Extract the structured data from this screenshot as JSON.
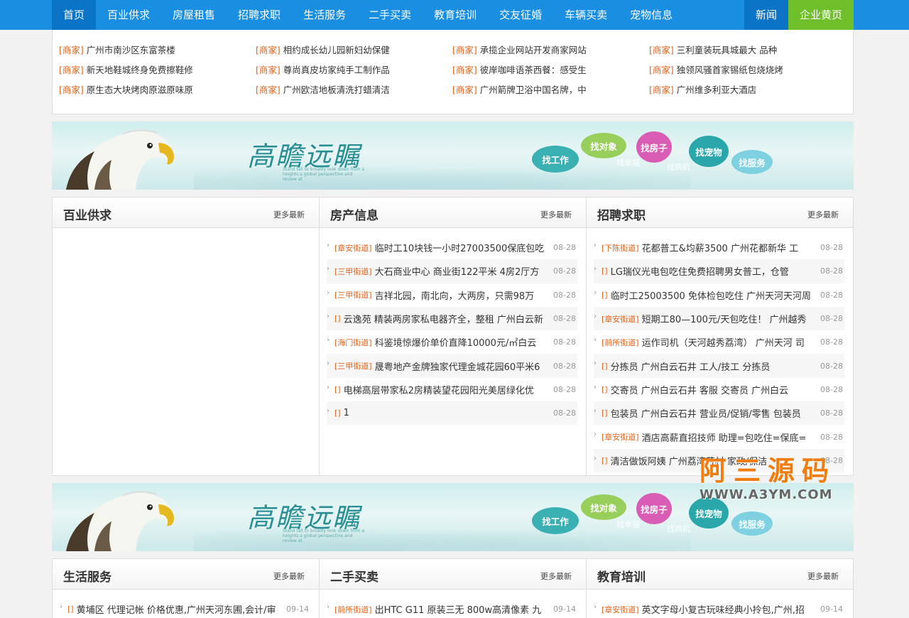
{
  "nav": {
    "items": [
      "首页",
      "百业供求",
      "房屋租售",
      "招聘求职",
      "生活服务",
      "二手买卖",
      "教育培训",
      "交友征婚",
      "车辆买卖",
      "宠物信息"
    ],
    "news": "新闻",
    "yellow_pages": "企业黄页"
  },
  "merchants": [
    {
      "tag": "[商家]",
      "text": "广州市南沙区东富茶楼"
    },
    {
      "tag": "[商家]",
      "text": "相约成长幼儿园新妇幼保健"
    },
    {
      "tag": "[商家]",
      "text": "承揽企业网站开发商家网站"
    },
    {
      "tag": "[商家]",
      "text": "三利童装玩具城最大 品种"
    },
    {
      "tag": "[商家]",
      "text": "新天地鞋城终身免费擦鞋修"
    },
    {
      "tag": "[商家]",
      "text": "尊尚真皮坊家纯手工制作品"
    },
    {
      "tag": "[商家]",
      "text": "彼岸咖啡语茶西餐：感受生"
    },
    {
      "tag": "[商家]",
      "text": "独领风骚首家锡纸包烧烧烤"
    },
    {
      "tag": "[商家]",
      "text": "原生态大块烤肉原滋原味原"
    },
    {
      "tag": "[商家]",
      "text": "广州欧洁地板清洗打蜡清洁"
    },
    {
      "tag": "[商家]",
      "text": "广州箭牌卫浴中国名牌，中"
    },
    {
      "tag": "[商家]",
      "text": "广州维多利亚大酒店"
    }
  ],
  "banner": {
    "calligraphy": "高瞻远瞩",
    "subtitle": "Stand tall to broadly look down from a heights a global perspective and review at",
    "bubbles": [
      "找工作",
      "找对象",
      "找房子",
      "找宠物",
      "找服务"
    ],
    "small": [
      "找幸福",
      "找商机"
    ]
  },
  "panels_top": [
    {
      "title": "百业供求",
      "more": "更多最新",
      "rows": []
    },
    {
      "title": "房产信息",
      "more": "更多最新",
      "rows": [
        {
          "tag": "[章安街道]",
          "text": "临时工10块钱一小时27003500保底包吃",
          "date": "08-28"
        },
        {
          "tag": "[三甲街道]",
          "text": "大石商业中心 商业街122平米 4房2厅方",
          "date": "08-28"
        },
        {
          "tag": "[三甲街道]",
          "text": "吉祥北园，南北向，大两房，只需98万",
          "date": "08-28"
        },
        {
          "tag": "[]",
          "text": "云逸苑 精装两房家私电器齐全，整租 广州白云新",
          "date": "08-28"
        },
        {
          "tag": "[海门街道]",
          "text": "科鉴境惊爆价单价直降10000元/㎡白云",
          "date": "08-28"
        },
        {
          "tag": "[三甲街道]",
          "text": "晟粤地产金牌独家代理金城花园60平米6",
          "date": "08-28"
        },
        {
          "tag": "[]",
          "text": "电梯高层带家私2房精装望花园阳光美居绿化优",
          "date": "08-28"
        },
        {
          "tag": "[]",
          "text": "1",
          "date": "08-28"
        }
      ]
    },
    {
      "title": "招聘求职",
      "more": "更多最新",
      "rows": [
        {
          "tag": "[下陈街道]",
          "text": "花都普工&均薪3500 广州花都新华 工",
          "date": "08-28"
        },
        {
          "tag": "[]",
          "text": "LG瑞仪光电包吃住免费招聘男女普工，仓管",
          "date": "08-28"
        },
        {
          "tag": "[]",
          "text": "临时工25003500 免体检包吃住 广州天河天河周",
          "date": "08-28"
        },
        {
          "tag": "[章安街道]",
          "text": "短期工80—100元/天包吃住！ 广州越秀",
          "date": "08-28"
        },
        {
          "tag": "[前所街道]",
          "text": "运作司机（天河越秀荔湾） 广州天河 司",
          "date": "08-28"
        },
        {
          "tag": "[]",
          "text": "分拣员 广州白云石井 工人/技工 分拣员",
          "date": "08-28"
        },
        {
          "tag": "[]",
          "text": "交寄员 广州白云石井 客服 交寄员 广州白云",
          "date": "08-28"
        },
        {
          "tag": "[]",
          "text": "包装员 广州白云石井 营业员/促销/零售 包装员",
          "date": "08-28"
        },
        {
          "tag": "[章安街道]",
          "text": "酒店高薪直招技师 助理=包吃住=保底=",
          "date": "08-28"
        },
        {
          "tag": "[]",
          "text": "清洁做饭阿姨 广州荔湾芳村 家政/保洁",
          "date": "08-28"
        }
      ]
    }
  ],
  "panels_bottom": [
    {
      "title": "生活服务",
      "more": "更多最新",
      "rows": [
        {
          "tag": "[]",
          "text": "黄埔区 代理记帐 价格优惠,广州天河东圃,会计/审",
          "date": "09-14"
        }
      ]
    },
    {
      "title": "二手买卖",
      "more": "更多最新",
      "rows": [
        {
          "tag": "[前所街道]",
          "text": "出HTC G11 原装三无 800w高清像素 九",
          "date": "09-14"
        }
      ]
    },
    {
      "title": "教育培训",
      "more": "更多最新",
      "rows": [
        {
          "tag": "[章安街道]",
          "text": "英文字母小复古玩味经典小拎包,广州,招",
          "date": "09-14"
        }
      ]
    }
  ],
  "watermark": {
    "line1": "阿三源码",
    "line2": "WWW.A3YM.COM"
  },
  "colors": {
    "nav": "#1a8ee0",
    "nav_active": "#0b74c6",
    "yellow_pages": "#6fbf2a",
    "tag": "#e0641c"
  }
}
